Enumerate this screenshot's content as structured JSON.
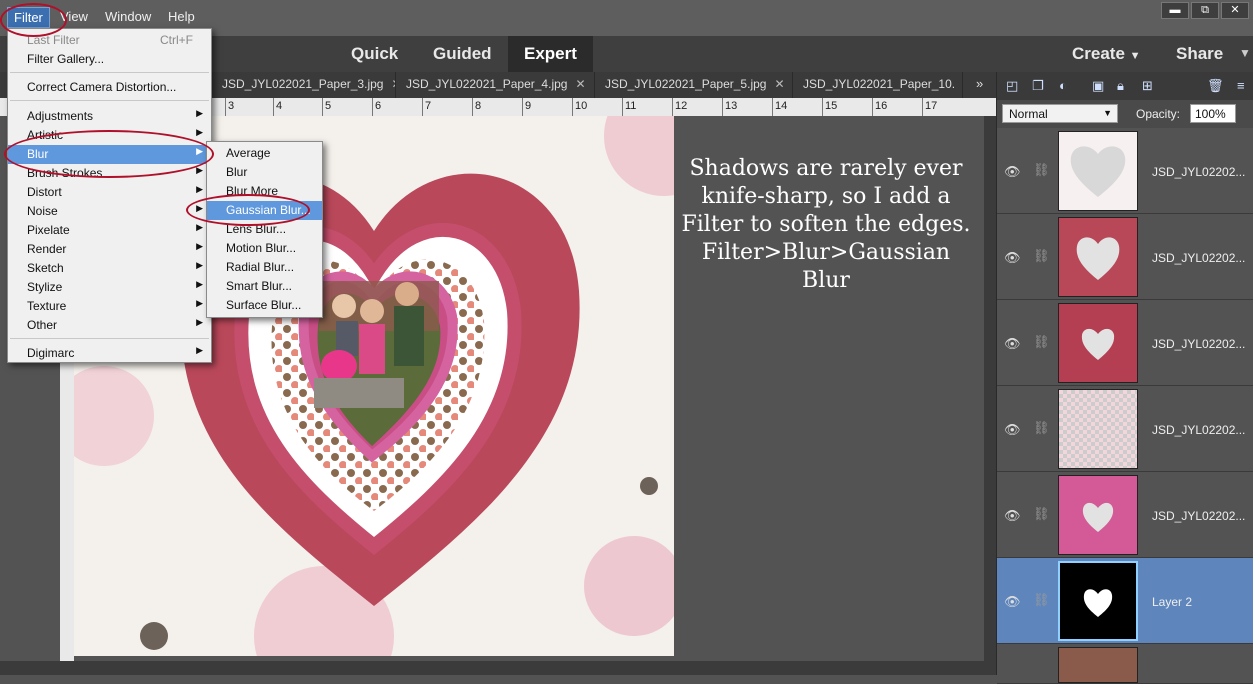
{
  "menubar": {
    "items": [
      "Filter",
      "View",
      "Window",
      "Help"
    ],
    "active": "Filter"
  },
  "window_controls": {
    "minimize": "▬",
    "restore": "⧉",
    "close": "✕"
  },
  "modes": {
    "quick": "Quick",
    "guided": "Guided",
    "expert": "Expert",
    "create": "Create",
    "share": "Share"
  },
  "tabs": [
    "JSD_JYL022021_Paper_3.jpg",
    "JSD_JYL022021_Paper_4.jpg",
    "JSD_JYL022021_Paper_5.jpg",
    "JSD_JYL022021_Paper_10."
  ],
  "tabs_overflow": "»",
  "ruler_marks": [
    "3",
    "4",
    "5",
    "6",
    "7",
    "8",
    "9",
    "10",
    "11",
    "12",
    "13",
    "14",
    "15",
    "16",
    "17"
  ],
  "filter_menu": {
    "last_filter": "Last Filter",
    "last_filter_shortcut": "Ctrl+F",
    "filter_gallery": "Filter Gallery...",
    "correct_camera": "Correct Camera Distortion...",
    "categories": [
      "Adjustments",
      "Artistic",
      "Blur",
      "Brush Strokes",
      "Distort",
      "Noise",
      "Pixelate",
      "Render",
      "Sketch",
      "Stylize",
      "Texture",
      "Other"
    ],
    "digimarc": "Digimarc"
  },
  "blur_submenu": [
    "Average",
    "Blur",
    "Blur More",
    "Gaussian Blur...",
    "Lens Blur...",
    "Motion Blur...",
    "Radial Blur...",
    "Smart Blur...",
    "Surface Blur..."
  ],
  "annotation": "Shadows are rarely ever\nknife-sharp, so I add a\nFilter to soften the edges.\nFilter>Blur>Gaussian Blur",
  "layers_panel": {
    "blend_mode": "Normal",
    "opacity_label": "Opacity:",
    "opacity_value": "100%",
    "layers": [
      {
        "name": "JSD_JYL02202...",
        "selected": false
      },
      {
        "name": "JSD_JYL02202...",
        "selected": false
      },
      {
        "name": "JSD_JYL02202...",
        "selected": false
      },
      {
        "name": "JSD_JYL02202...",
        "selected": false
      },
      {
        "name": "JSD_JYL02202...",
        "selected": false
      },
      {
        "name": "Layer 2",
        "selected": true
      }
    ]
  },
  "colors": {
    "highlight": "#5f98dc",
    "annotation_ring": "#b0102a",
    "heart_outer": "#b9485a",
    "heart_pink": "#d9609a"
  }
}
